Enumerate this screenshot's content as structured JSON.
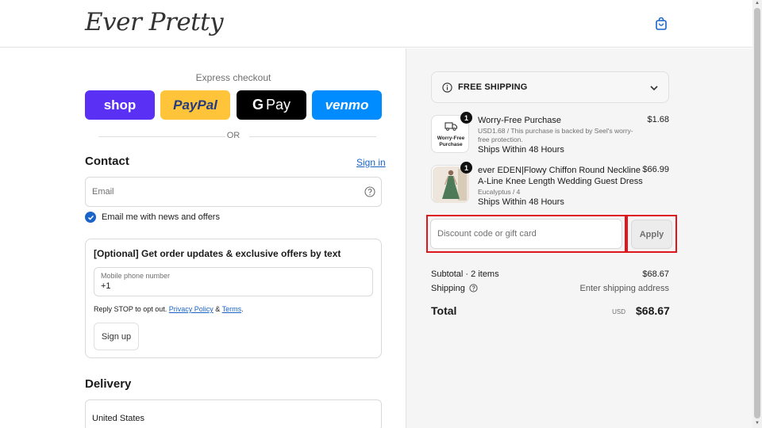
{
  "header": {
    "logo": "Ever Pretty",
    "cart_icon": "shopping-bag-icon"
  },
  "express": {
    "title": "Express checkout",
    "buttons": {
      "shop": "shop",
      "paypal": "PayPal",
      "gpay_g": "G",
      "gpay": "Pay",
      "venmo": "venmo"
    },
    "or": "OR"
  },
  "contact": {
    "heading": "Contact",
    "sign_in": "Sign in",
    "email_placeholder": "Email",
    "news_checkbox_label": "Email me with news and offers",
    "news_checked": true
  },
  "sms": {
    "title": "[Optional] Get order updates & exclusive offers by text",
    "phone_label": "Mobile phone number",
    "phone_value": "+1",
    "note_prefix": "Reply STOP to opt out.",
    "privacy_link": "Privacy Policy",
    "amp": "&",
    "terms_link": "Terms",
    "period": ".",
    "signup_button": "Sign up"
  },
  "delivery": {
    "heading": "Delivery",
    "country": "United States"
  },
  "summary": {
    "shipping_banner": "FREE SHIPPING",
    "items": [
      {
        "qty": "1",
        "thumb_text_1": "Worry-Free",
        "thumb_text_2": "Purchase",
        "name": "Worry-Free Purchase",
        "desc": "USD1.68 / This purchase is backed by Seel's worry-free protection.",
        "shipping": "Ships Within 48 Hours",
        "price": "$1.68"
      },
      {
        "qty": "1",
        "name_line1": "ever EDEN|Flowy Chiffon Round Neckline",
        "name_line2": "A-Line Knee Length Wedding Guest Dress",
        "variant": "Eucalyptus / 4",
        "shipping": "Ships Within 48 Hours",
        "price": "$66.99"
      }
    ],
    "discount_placeholder": "Discount code or gift card",
    "apply_button": "Apply",
    "subtotal_label": "Subtotal · 2 items",
    "subtotal_value": "$68.67",
    "shipping_label": "Shipping",
    "shipping_value": "Enter shipping address",
    "total_label": "Total",
    "total_currency": "USD",
    "total_value": "$68.67"
  },
  "colors": {
    "accent": "#1a64c9",
    "highlight": "#e0161d",
    "shop": "#5a31f4",
    "paypal": "#ffc439",
    "venmo": "#008cff"
  }
}
